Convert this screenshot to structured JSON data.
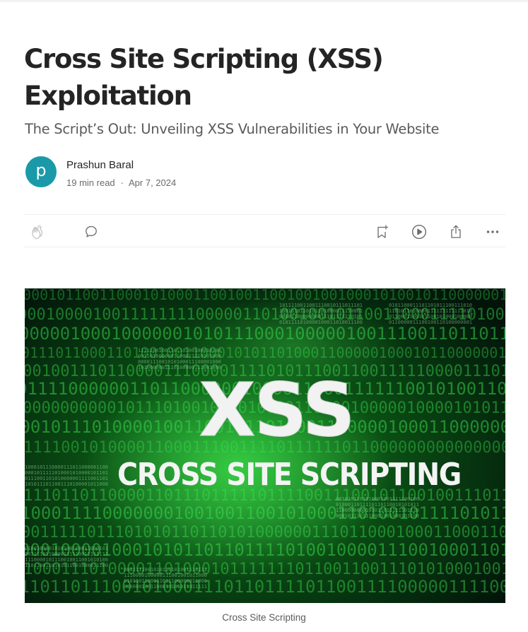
{
  "article": {
    "title": "Cross Site Scripting (XSS) Exploitation",
    "subtitle": "The Script’s Out: Unveiling XSS Vulnerabilities in Your Website"
  },
  "author": {
    "avatar_letter": "p",
    "name": "Prashun Baral",
    "read_time": "19 min read",
    "separator": "·",
    "date": "Apr 7, 2024"
  },
  "actions": {
    "clap_icon": "clap-icon",
    "comment_icon": "comment-icon",
    "save_icon": "bookmark-add-icon",
    "listen_icon": "play-circle-icon",
    "share_icon": "share-icon",
    "more_icon": "more-dots-icon"
  },
  "hero": {
    "headline": "XSS",
    "tagline": "CROSS SITE  SCRIPTING",
    "caption": "Cross Site Scripting"
  },
  "colors": {
    "avatar_bg": "#1a9aa8",
    "hero_green": "#1fbf3a",
    "hero_dark": "#041a06"
  }
}
